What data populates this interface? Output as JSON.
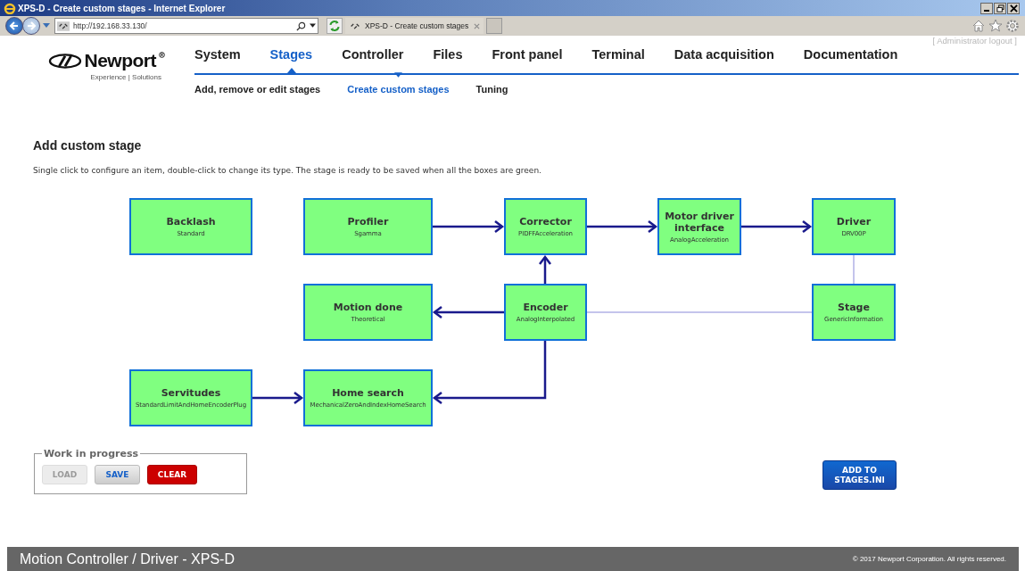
{
  "window": {
    "title": "XPS-D - Create custom stages - Internet Explorer"
  },
  "browser": {
    "address": "http://192.168.33.130/",
    "tab": "XPS-D - Create custom stages"
  },
  "header": {
    "logo": "Newport",
    "tagline": "Experience | Solutions",
    "logout": "[ Administrator logout ]"
  },
  "nav": [
    {
      "label": "System",
      "selected": false
    },
    {
      "label": "Stages",
      "selected": true
    },
    {
      "label": "Controller",
      "selected": false
    },
    {
      "label": "Files",
      "selected": false
    },
    {
      "label": "Front panel",
      "selected": false
    },
    {
      "label": "Terminal",
      "selected": false
    },
    {
      "label": "Data acquisition",
      "selected": false
    },
    {
      "label": "Documentation",
      "selected": false
    }
  ],
  "subnav": [
    {
      "label": "Add, remove or edit stages",
      "selected": false
    },
    {
      "label": "Create custom stages",
      "selected": true
    },
    {
      "label": "Tuning",
      "selected": false
    }
  ],
  "page": {
    "title": "Add custom stage",
    "instructions": "Single click to configure an item, double-click to change its type. The stage is ready to be saved when all the boxes are green."
  },
  "diagram": {
    "nodes": [
      {
        "title": "Backlash",
        "type": "Standard",
        "configured": true
      },
      {
        "title": "Profiler",
        "type": "Sgamma",
        "configured": true
      },
      {
        "title": "Corrector",
        "type": "PIDFFAcceleration",
        "configured": true
      },
      {
        "title": "Motor driver interface",
        "type": "AnalogAcceleration",
        "configured": true
      },
      {
        "title": "Driver",
        "type": "DRV00P",
        "configured": true
      },
      {
        "title": "Motion done",
        "type": "Theoretical",
        "configured": true
      },
      {
        "title": "Encoder",
        "type": "AnalogInterpolated",
        "configured": true
      },
      {
        "title": "Stage",
        "type": "GenericInformation",
        "configured": true
      },
      {
        "title": "Servitudes",
        "type": "StandardLimitAndHomeEncoderPlug",
        "configured": true
      },
      {
        "title": "Home search",
        "type": "MechanicalZeroAndIndexHomeSearch",
        "configured": true
      }
    ]
  },
  "work_in_progress": {
    "legend": "Work in progress",
    "buttons": [
      {
        "label": "LOAD",
        "kind": "plain",
        "disabled": true
      },
      {
        "label": "SAVE",
        "kind": "plain",
        "disabled": false
      },
      {
        "label": "CLEAR",
        "kind": "danger",
        "disabled": false
      }
    ]
  },
  "add_button": {
    "label": "ADD TO STAGES.INI"
  },
  "footer": {
    "product": "Motion Controller / Driver - XPS-D",
    "copyright": "© 2017 Newport Corporation. All rights reserved."
  }
}
